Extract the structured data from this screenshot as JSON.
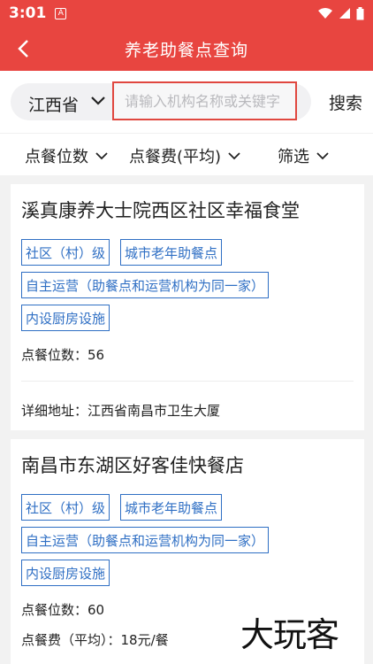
{
  "status_bar": {
    "time": "3:01",
    "app_icon": "A",
    "icons": [
      "wifi-icon",
      "signal-icon",
      "battery-icon"
    ]
  },
  "header": {
    "title": "养老助餐点查询",
    "back_icon": "chevron-left-icon"
  },
  "search": {
    "province": "江西省",
    "placeholder": "请输入机构名称或关键字",
    "button": "搜索"
  },
  "filters": [
    {
      "label": "点餐位数"
    },
    {
      "label": "点餐费(平均)"
    },
    {
      "label": "筛选"
    }
  ],
  "cards": [
    {
      "name": "溪真康养大士院西区社区幸福食堂",
      "tags": [
        "社区（村）级",
        "城市老年助餐点",
        "自主运营（助餐点和运营机构为同一家）",
        "内设厨房设施"
      ],
      "seats": "点餐位数：56",
      "address": "详细地址：江西省南昌市卫生大厦"
    },
    {
      "name": "南昌市东湖区好客佳快餐店",
      "tags": [
        "社区（村）级",
        "城市老年助餐点",
        "自主运营（助餐点和运营机构为同一家）",
        "内设厨房设施"
      ],
      "seats": "点餐位数：60",
      "fee": "点餐费（平均）：18元/餐"
    }
  ],
  "watermark": "大玩客",
  "colors": {
    "brand_red": "#e84540",
    "tag_blue": "#2f6fc4",
    "search_border": "#e0473f"
  }
}
